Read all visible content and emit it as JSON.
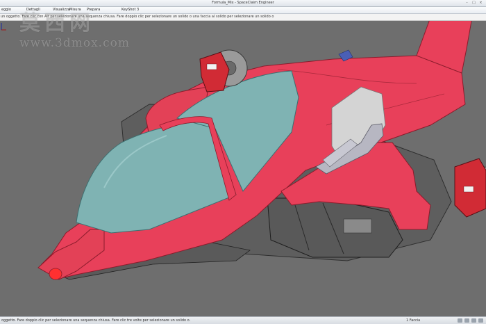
{
  "window": {
    "title": "Formula_Mix - SpaceClaim Engineer",
    "controls": [
      "–",
      "□",
      "×"
    ]
  },
  "ribbon": {
    "tabs": [
      {
        "label": "eggio"
      },
      {
        "label": "Dettagli"
      },
      {
        "label": "Visualizza"
      },
      {
        "label": "Misura"
      },
      {
        "label": "Prepara"
      },
      {
        "label": "KeyShot 3"
      }
    ]
  },
  "hint": {
    "text": "un oggetto. Fare clic con Alt per selezionare una sequenza chiusa. Fare doppio clic per selezionare un solido o una faccia al solido per selezionare un solido o"
  },
  "status": {
    "text": "oggetto. Fare doppio clic per selezionare una sequenza chiusa. Fare clic tre volte per selezionare un solido o.",
    "right": "1 Faccia"
  },
  "watermark": {
    "chinese": "莫西网",
    "url": "www.3dmox.com"
  },
  "colors": {
    "body": "#e8405a",
    "canopy": "#7fb3b3",
    "chassis": "#5a5a5a",
    "viewport": "#6e6e6e"
  },
  "icons": {
    "brake_caliper": "brake-caliper-icon",
    "engine_exhaust": "exhaust-icon"
  }
}
